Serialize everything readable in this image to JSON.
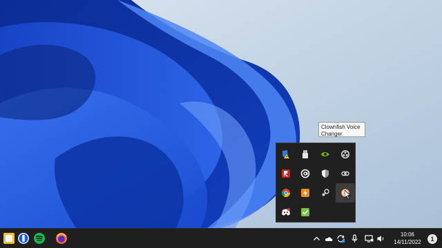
{
  "tooltip": {
    "text": "Clownfish Voice Changer"
  },
  "tray_flyout": {
    "icons": [
      {
        "name": "vpn-shield-warning-icon"
      },
      {
        "name": "usb-drive-icon"
      },
      {
        "name": "nvidia-icon"
      },
      {
        "name": "obs-studio-icon"
      },
      {
        "name": "red-r-app-icon"
      },
      {
        "name": "at-sign-app-icon"
      },
      {
        "name": "security-shield-icon"
      },
      {
        "name": "cloud-link-icon"
      },
      {
        "name": "chrome-icon"
      },
      {
        "name": "orange-lightning-app-icon"
      },
      {
        "name": "steam-icon"
      },
      {
        "name": "clownfish-voice-changer-icon"
      },
      {
        "name": "discord-icon"
      },
      {
        "name": "green-check-app-icon"
      }
    ]
  },
  "taskbar": {
    "apps": [
      {
        "name": "start-tile-icon"
      },
      {
        "name": "bitwarden-icon"
      },
      {
        "name": "spotify-icon"
      },
      {
        "name": "firefox-icon"
      }
    ],
    "system_tray": [
      {
        "name": "show-hidden-icons-chevron-icon"
      },
      {
        "name": "onedrive-cloud-icon"
      },
      {
        "name": "sync-icon"
      },
      {
        "name": "microphone-icon"
      },
      {
        "name": "display-icon"
      },
      {
        "name": "volume-icon"
      }
    ],
    "clock": {
      "time": "10:06",
      "date": "14/11/2022"
    },
    "notification_count": "1"
  },
  "colors": {
    "wallpaper_bg": "#c8d7e6",
    "bloom_dark": "#0a2a8a",
    "bloom_mid": "#1c4fd8",
    "bloom_light": "#3f78f0",
    "taskbar_bg": "#1f1f1f",
    "flyout_bg": "#202020"
  }
}
